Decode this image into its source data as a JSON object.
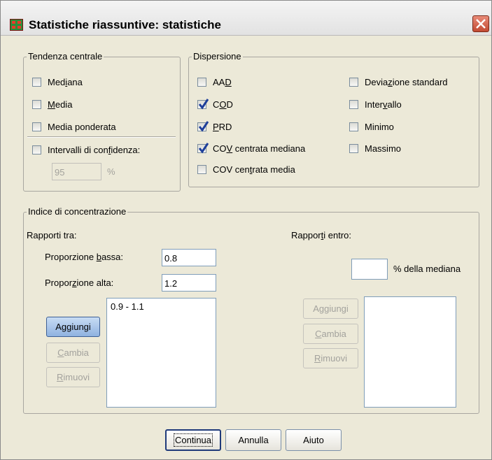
{
  "title": "Statistiche riassuntive: statistiche",
  "central": {
    "legend": "Tendenza centrale",
    "mediana": {
      "pre": "Med",
      "key": "i",
      "post": "ana",
      "checked": false
    },
    "media": {
      "pre": "",
      "key": "M",
      "post": "edia",
      "checked": false
    },
    "ponderata": {
      "label": "Media ponderata",
      "checked": false
    },
    "intervalli": {
      "pre": "Intervalli di con",
      "key": "f",
      "post": "idenza:",
      "checked": false
    },
    "conf_value": "95",
    "conf_unit": "%"
  },
  "dispersion": {
    "legend": "Dispersione",
    "aad": {
      "pre": "AA",
      "key": "D",
      "post": "",
      "checked": false
    },
    "cod": {
      "pre": "C",
      "key": "O",
      "post": "D",
      "checked": true
    },
    "prd": {
      "pre": "",
      "key": "P",
      "post": "RD",
      "checked": true
    },
    "cov_mediana": {
      "pre": "CO",
      "key": "V",
      "post": " centrata mediana",
      "checked": true
    },
    "cov_media": {
      "pre": "COV cen",
      "key": "t",
      "post": "rata media",
      "checked": false
    },
    "devstd": {
      "pre": "Devia",
      "key": "z",
      "post": "ione standard",
      "checked": false
    },
    "intervallo": {
      "pre": "Inter",
      "key": "v",
      "post": "allo",
      "checked": false
    },
    "minimo": {
      "label": "Minimo",
      "checked": false
    },
    "massimo": {
      "label": "Massimo",
      "checked": false
    }
  },
  "concentration": {
    "legend": "Indice di concentrazione",
    "between_label": "Rapporti tra:",
    "low_label": {
      "pre": "Proporzione ",
      "key": "b",
      "post": "assa:"
    },
    "low_value": "0.8",
    "high_label": {
      "pre": "Propor",
      "key": "z",
      "post": "ione alta:"
    },
    "high_value": "1.2",
    "between_list": [
      "0.9 - 1.1"
    ],
    "add": {
      "pre": "A",
      "key": "g",
      "post": "giungi"
    },
    "change": {
      "pre": "",
      "key": "C",
      "post": "ambia"
    },
    "remove": {
      "pre": "",
      "key": "R",
      "post": "imuovi"
    },
    "within_label": {
      "pre": "Rappor",
      "key": "t",
      "post": "i entro:"
    },
    "within_value": "",
    "within_suffix": "% della mediana",
    "add2": {
      "pre": "A",
      "key": "g",
      "post": "giungi"
    },
    "change2": {
      "pre": "",
      "key": "C",
      "post": "ambia"
    },
    "remove2": {
      "pre": "",
      "key": "R",
      "post": "imuovi"
    },
    "within_list": []
  },
  "footer": {
    "continue": "Continua",
    "cancel": "Annulla",
    "help": "Aiuto"
  },
  "colors": {
    "window": "#ece9d8",
    "border": "#a8a6a0",
    "check": "#1e3f9a",
    "disabled_text": "#a3a29d"
  }
}
